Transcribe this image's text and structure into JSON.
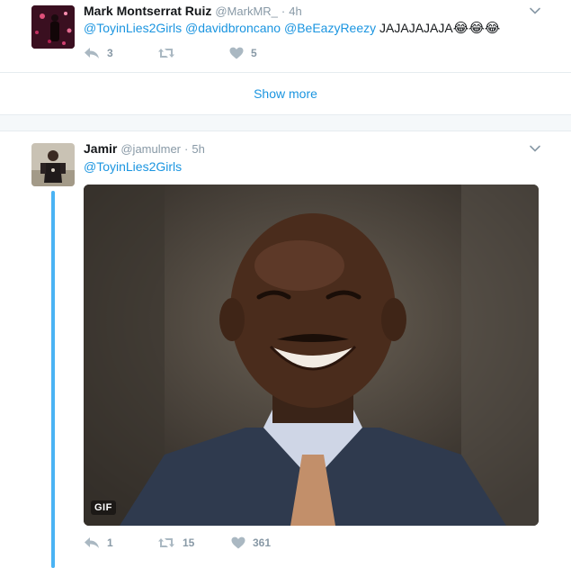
{
  "tweet1": {
    "fullname": "Mark Montserrat Ruiz",
    "screen_name": "@MarkMR_",
    "dot": "·",
    "time": "4h",
    "mentions": [
      "@ToyinLies2Girls",
      "@davidbroncano",
      "@BeEazyReezy"
    ],
    "text": "JAJAJAJAJA",
    "emojis": "😂😂😂",
    "reply_count": "3",
    "retweet_count": "",
    "like_count": "5"
  },
  "show_more": "Show more",
  "tweet2": {
    "fullname": "Jamir",
    "screen_name": "@jamulmer",
    "dot": "·",
    "time": "5h",
    "mention": "@ToyinLies2Girls",
    "media_badge": "GIF",
    "reply_count": "1",
    "retweet_count": "15",
    "like_count": "361"
  },
  "icons": {
    "reply": "reply-icon",
    "retweet": "retweet-icon",
    "like": "heart-icon",
    "more": "chevron-down-icon"
  },
  "colors": {
    "link": "#1b95e0",
    "muted": "#8899a6",
    "thread": "#4ab3f4",
    "divider": "#e6ecf0"
  }
}
